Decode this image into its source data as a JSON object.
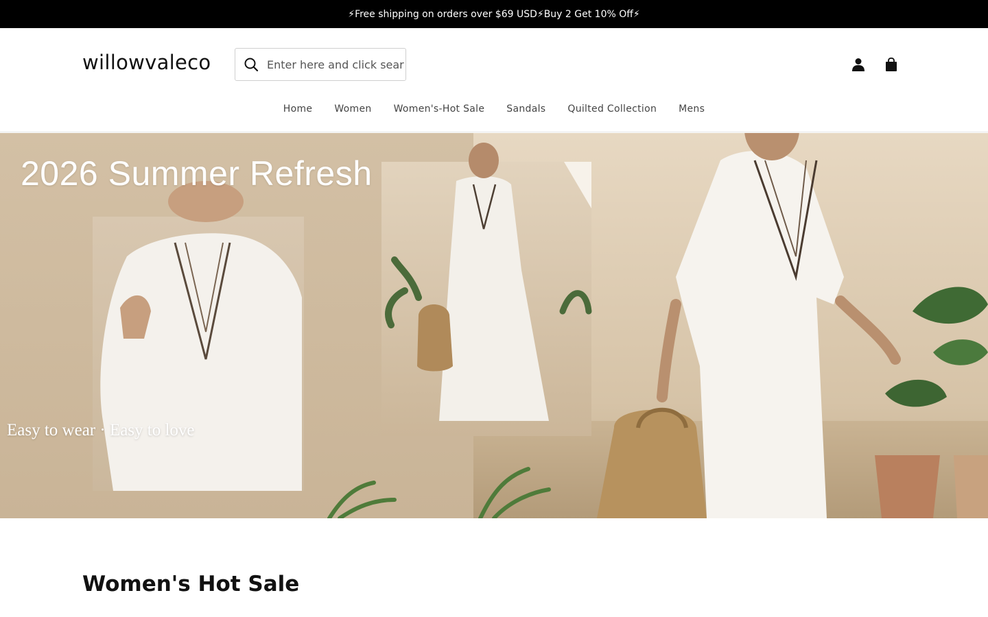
{
  "announcement": {
    "text": "⚡Free shipping on orders over $69 USD⚡Buy 2 Get 10% Off⚡"
  },
  "header": {
    "logo": "willowvaleco",
    "search": {
      "placeholder": "Enter here and click search",
      "icon": "search-icon"
    },
    "icons": [
      "account-icon",
      "cart-icon"
    ]
  },
  "nav": {
    "items": [
      {
        "label": "Home"
      },
      {
        "label": "Women"
      },
      {
        "label": "Women's-Hot Sale"
      },
      {
        "label": "Sandals"
      },
      {
        "label": "Quilted Collection"
      },
      {
        "label": "Mens"
      }
    ]
  },
  "hero": {
    "title": "2026 Summer Refresh",
    "tagline": "Easy to wear · Easy to love"
  },
  "section": {
    "title": "Women's Hot Sale"
  },
  "colors": {
    "announcement_bg": "#000000",
    "announcement_text": "#ffffff",
    "hero_bg": "#d9c6ad"
  }
}
